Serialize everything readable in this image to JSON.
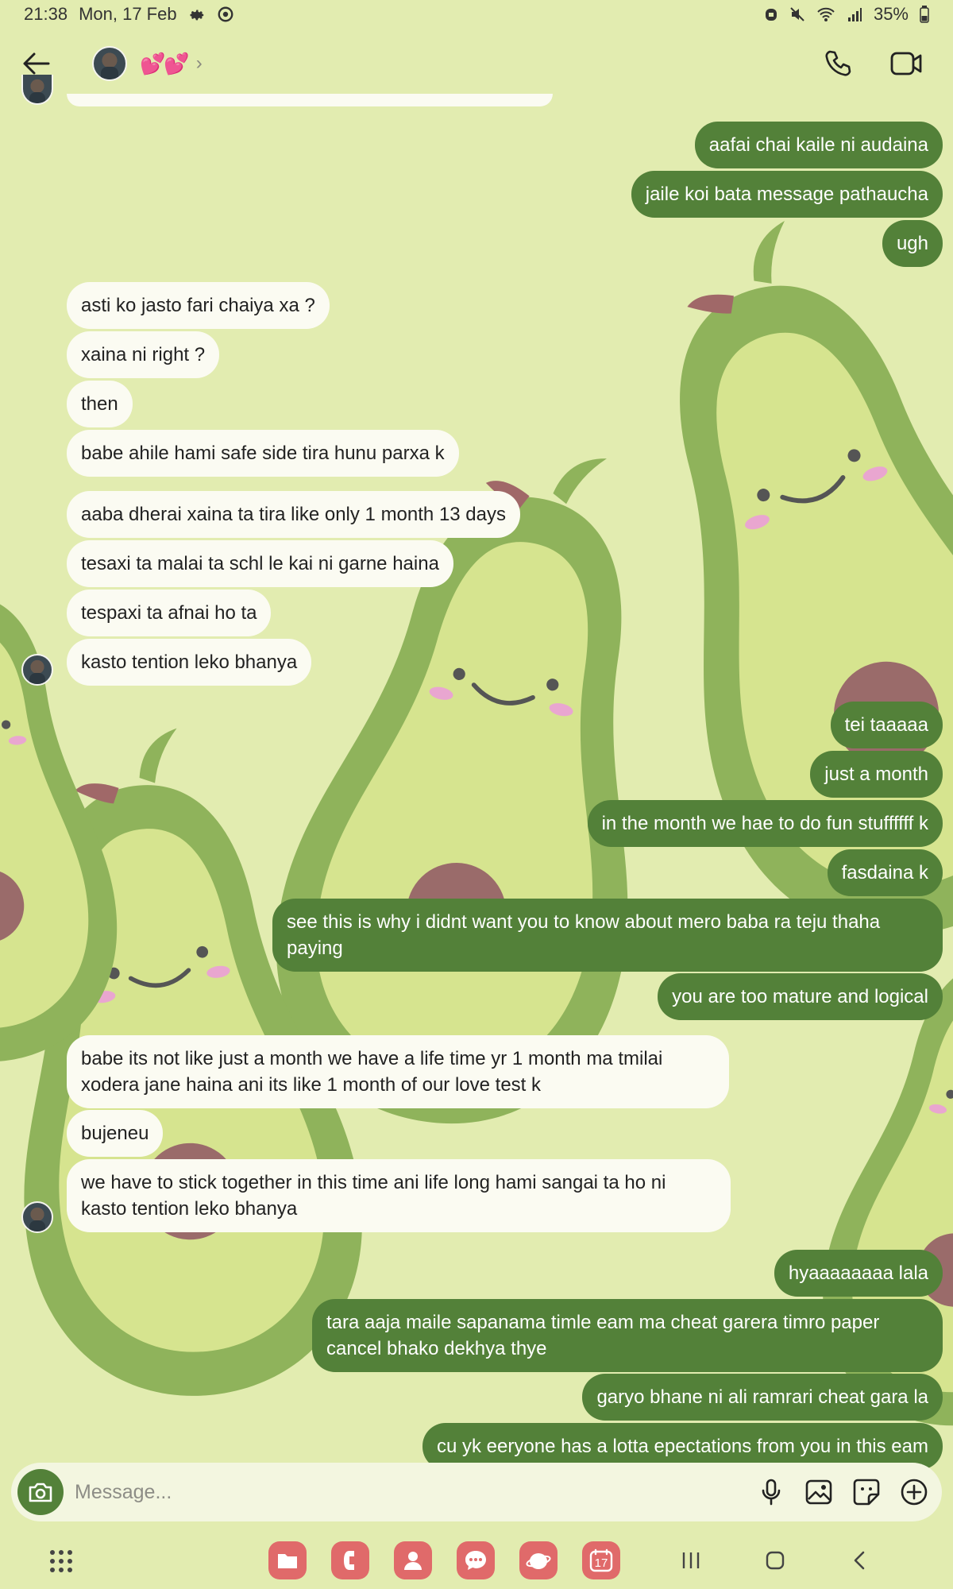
{
  "status_bar": {
    "time": "21:38",
    "date": "Mon, 17 Feb",
    "battery": "35%",
    "icons": [
      "gear-icon",
      "sync-icon",
      "alarm-icon",
      "mute-icon",
      "wifi-icon",
      "signal-icon",
      "battery-icon"
    ]
  },
  "header": {
    "contact_name": "💕💕",
    "chevron": "›",
    "icons": [
      "back-arrow-icon",
      "phone-icon",
      "video-call-icon"
    ]
  },
  "messages": [
    {
      "dir": "in",
      "text": "",
      "partial": true
    },
    {
      "dir": "out",
      "text": "aafai chai kaile ni audaina"
    },
    {
      "dir": "out",
      "text": "jaile koi bata message pathaucha"
    },
    {
      "dir": "out",
      "text": "ugh"
    },
    {
      "dir": "in",
      "text": "asti ko jasto fari chaiya xa ?"
    },
    {
      "dir": "in",
      "text": "xaina ni right ?"
    },
    {
      "dir": "in",
      "text": "then"
    },
    {
      "dir": "in",
      "text": "babe ahile hami safe side tira hunu parxa k"
    },
    {
      "dir": "in",
      "text": "aaba dherai xaina ta tira like only 1 month 13 days"
    },
    {
      "dir": "in",
      "text": "tesaxi ta malai ta schl le kai ni garne haina"
    },
    {
      "dir": "in",
      "text": "tespaxi ta afnai ho ta"
    },
    {
      "dir": "in",
      "text": "kasto tention leko bhanya"
    },
    {
      "dir": "out",
      "text": "tei taaaaa"
    },
    {
      "dir": "out",
      "text": "just a month"
    },
    {
      "dir": "out",
      "text": "in the month we hae to do fun stuffffff k"
    },
    {
      "dir": "out",
      "text": "fasdaina k"
    },
    {
      "dir": "out",
      "text": "see this is why i didnt want you to know about mero baba ra teju thaha\npaying"
    },
    {
      "dir": "out",
      "text": "you are too mature and logical"
    },
    {
      "dir": "in",
      "text": "babe its not like just a month we have a life time yr 1 month ma tmilai\nxodera jane haina ani its like 1 month of our love test k"
    },
    {
      "dir": "in",
      "text": "bujeneu"
    },
    {
      "dir": "in",
      "text": "we have to stick together in this time ani life long hami sangai ta ho ni\nkasto tention leko bhanya"
    },
    {
      "dir": "out",
      "text": "hyaaaaaaaa lala"
    },
    {
      "dir": "out",
      "text": "tara aaja maile sapanama timle eam ma cheat garera timro paper\ncancel bhako dekhya thye"
    },
    {
      "dir": "out",
      "text": "garyo bhane ni ali ramrari cheat gara la"
    },
    {
      "dir": "out",
      "text": "cu yk eeryone has a lotta epectations from you in this eam"
    }
  ],
  "composer": {
    "placeholder": "Message...",
    "icons": [
      "camera-icon",
      "microphone-icon",
      "gallery-icon",
      "sticker-icon",
      "add-icon"
    ]
  },
  "taskbar": {
    "calendar_day": "17",
    "apps": [
      "files-icon",
      "phone-app-icon",
      "contacts-icon",
      "messages-icon",
      "browser-icon",
      "calendar-icon"
    ],
    "nav": [
      "recents-icon",
      "home-icon",
      "back-icon"
    ]
  },
  "colors": {
    "background": "#e2ecb0",
    "outgoing_bubble": "#538139",
    "incoming_bubble": "#fbfbf2",
    "avocado_outer": "#8fb35b",
    "avocado_inner": "#d6e48f",
    "avocado_pit": "#9a6b6a",
    "dock_icon": "#e06a6a"
  }
}
